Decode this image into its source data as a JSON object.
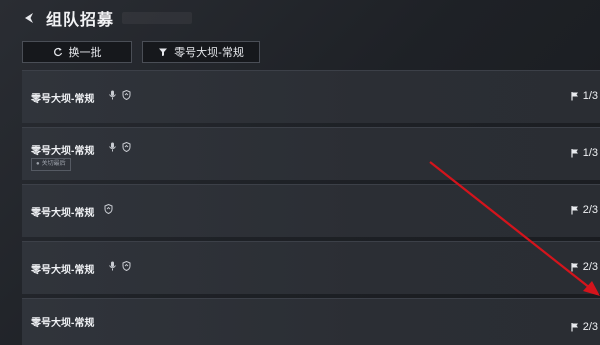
{
  "header": {
    "title": "组队招募",
    "back_icon": "back-arrow-icon"
  },
  "toolbar": {
    "refresh_label": "换一批",
    "refresh_icon": "refresh-icon",
    "filter_label": "零号大坝-常规",
    "filter_icon": "filter-icon"
  },
  "rows": [
    {
      "name": "零号大坝-常规",
      "icons": [
        "mic-icon",
        "shield-icon"
      ],
      "tag": "",
      "count": "1/3"
    },
    {
      "name": "零号大坝-常规",
      "icons": [
        "mic-icon",
        "shield-icon"
      ],
      "tag": "关切最后",
      "count": "1/3"
    },
    {
      "name": "零号大坝-常规",
      "icons": [
        "shield-icon"
      ],
      "tag": "",
      "count": "2/3"
    },
    {
      "name": "零号大坝-常规",
      "icons": [
        "mic-icon",
        "shield-icon"
      ],
      "tag": "",
      "count": "2/3"
    },
    {
      "name": "零号大坝-常规",
      "icons": [],
      "tag": "",
      "count": "2/3"
    }
  ],
  "colors": {
    "background": "#1f2227",
    "card": "#2e3238",
    "annotation_arrow": "#d4141c"
  }
}
